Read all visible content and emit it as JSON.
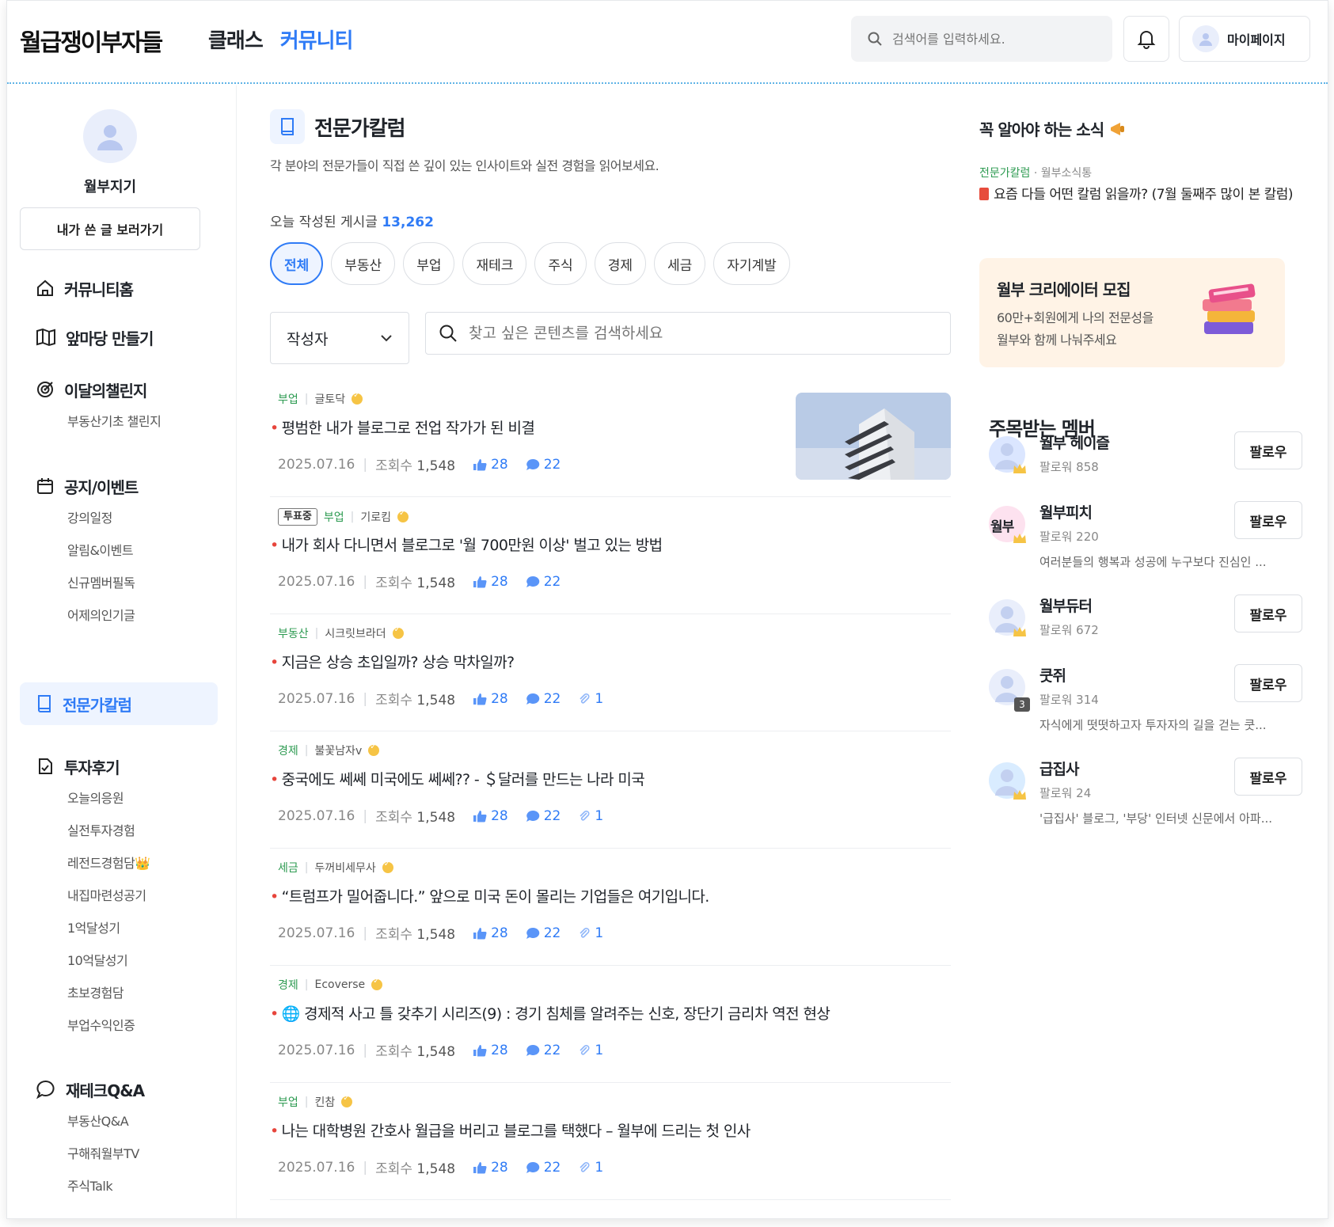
{
  "header": {
    "logo": "월급쟁이부자들",
    "nav": [
      "클래스",
      "커뮤니티"
    ],
    "search_placeholder": "검색어를 입력하세요.",
    "mypage": "마이페이지"
  },
  "sidebar": {
    "username": "월부지기",
    "my_posts_button": "내가 쓴 글 보러가기",
    "groups": [
      {
        "label": "커뮤니티홈",
        "icon": "home-icon",
        "subs": []
      },
      {
        "label": "앞마당 만들기",
        "icon": "map-icon",
        "subs": []
      },
      {
        "label": "이달의챌린지",
        "icon": "target-icon",
        "subs": [
          "부동산기초 챌린지"
        ]
      },
      {
        "label": "공지/이벤트",
        "icon": "calendar-icon",
        "subs": [
          "강의일정",
          "알림&이벤트",
          "신규멤버필독",
          "어제의인기글"
        ]
      },
      {
        "label": "전문가칼럼",
        "icon": "book-icon",
        "subs": []
      },
      {
        "label": "투자후기",
        "icon": "review-icon",
        "subs": [
          "오늘의응원",
          "실전투자경험",
          "레전드경험담👑",
          "내집마련성공기",
          "1억달성기",
          "10억달성기",
          "초보경험담",
          "부업수익인증"
        ]
      },
      {
        "label": "재테크Q&A",
        "icon": "chat-icon",
        "subs": [
          "부동산Q&A",
          "구해줘월부TV",
          "주식Talk"
        ]
      }
    ]
  },
  "main": {
    "title": "전문가칼럼",
    "description": "각 분야의 전문가들이 직접 쓴 깊이 있는 인사이트와 실전 경험을 읽어보세요.",
    "today_label": "오늘 작성된 게시글",
    "today_count": "13,262",
    "chips": [
      "전체",
      "부동산",
      "부업",
      "재테크",
      "주식",
      "경제",
      "세금",
      "자기계발"
    ],
    "filter_select": "작성자",
    "search_placeholder": "찾고 싶은 콘텐츠를 검색하세요",
    "posts": [
      {
        "vote": "",
        "category": "부업",
        "author": "글토닥",
        "title": "평범한 내가 블로그로 전업 작가가 된 비결",
        "date": "2025.07.16",
        "views_label": "조회수",
        "views": "1,548",
        "likes": "28",
        "comments": "22",
        "attachments": ""
      },
      {
        "vote": "투표중",
        "category": "부업",
        "author": "기로킴",
        "title": "내가 회사 다니면서 블로그로 '월 700만원 이상' 벌고 있는 방법",
        "date": "2025.07.16",
        "views_label": "조회수",
        "views": "1,548",
        "likes": "28",
        "comments": "22",
        "attachments": ""
      },
      {
        "vote": "",
        "category": "부동산",
        "author": "시크릿브라더",
        "title": "지금은 상승 초입일까? 상승 막차일까?",
        "date": "2025.07.16",
        "views_label": "조회수",
        "views": "1,548",
        "likes": "28",
        "comments": "22",
        "attachments": "1"
      },
      {
        "vote": "",
        "category": "경제",
        "author": "불꽃남자v",
        "title": "중국에도 쎄쎄 미국에도 쎄쎄?? - ＄달러를 만드는 나라 미국",
        "date": "2025.07.16",
        "views_label": "조회수",
        "views": "1,548",
        "likes": "28",
        "comments": "22",
        "attachments": "1"
      },
      {
        "vote": "",
        "category": "세금",
        "author": "두꺼비세무사",
        "title": "“트럼프가 밀어줍니다.” 앞으로 미국 돈이 몰리는 기업들은 여기입니다.",
        "date": "2025.07.16",
        "views_label": "조회수",
        "views": "1,548",
        "likes": "28",
        "comments": "22",
        "attachments": "1"
      },
      {
        "vote": "",
        "category": "경제",
        "author": "Ecoverse",
        "title": "🌐 경제적 사고 틀 갖추기 시리즈(9) : 경기 침체를 알려주는 신호, 장단기 금리차 역전 현상",
        "date": "2025.07.16",
        "views_label": "조회수",
        "views": "1,548",
        "likes": "28",
        "comments": "22",
        "attachments": "1"
      },
      {
        "vote": "",
        "category": "부업",
        "author": "킨참",
        "title": "나는 대학병원 간호사 월급을 버리고 블로그를 택했다 – 월부에 드리는 첫 인사",
        "date": "2025.07.16",
        "views_label": "조회수",
        "views": "1,548",
        "likes": "28",
        "comments": "22",
        "attachments": "1"
      }
    ]
  },
  "right": {
    "news_title": "꼭 알아야 하는 소식",
    "news_category": "전문가칼럼",
    "news_source": "월부소식통",
    "news_text": "요즘 다들 어떤 칼럼 읽을까? (7월 둘째주 많이 본 칼럼)",
    "banner_title": "월부 크리에이터 모집",
    "banner_desc_1": "60만+회원에게 나의 전문성을",
    "banner_desc_2": "월부와 함께 나눠주세요",
    "members_title": "주목받는 멤버",
    "follow_label": "팔로우",
    "members": [
      {
        "name": "월부 헤이즐",
        "followers": "팔로워 858",
        "desc": "",
        "avatar_text": "",
        "badge": ""
      },
      {
        "name": "월부피치",
        "followers": "팔로워 220",
        "desc": "여러분들의 행복과 성공에 누구보다 진심인 ...",
        "avatar_text": "월부",
        "badge": ""
      },
      {
        "name": "월부듀터",
        "followers": "팔로워 672",
        "desc": "",
        "avatar_text": "",
        "badge": ""
      },
      {
        "name": "쿳쥐",
        "followers": "팔로워 314",
        "desc": "자식에게 떳떳하고자 투자자의 길을 걷는 쿳...",
        "avatar_text": "",
        "badge": "3"
      },
      {
        "name": "급집사",
        "followers": "팔로워 24",
        "desc": "'급집사' 블로그, '부당' 인터넷 신문에서 아파...",
        "avatar_text": "",
        "badge": ""
      }
    ]
  }
}
